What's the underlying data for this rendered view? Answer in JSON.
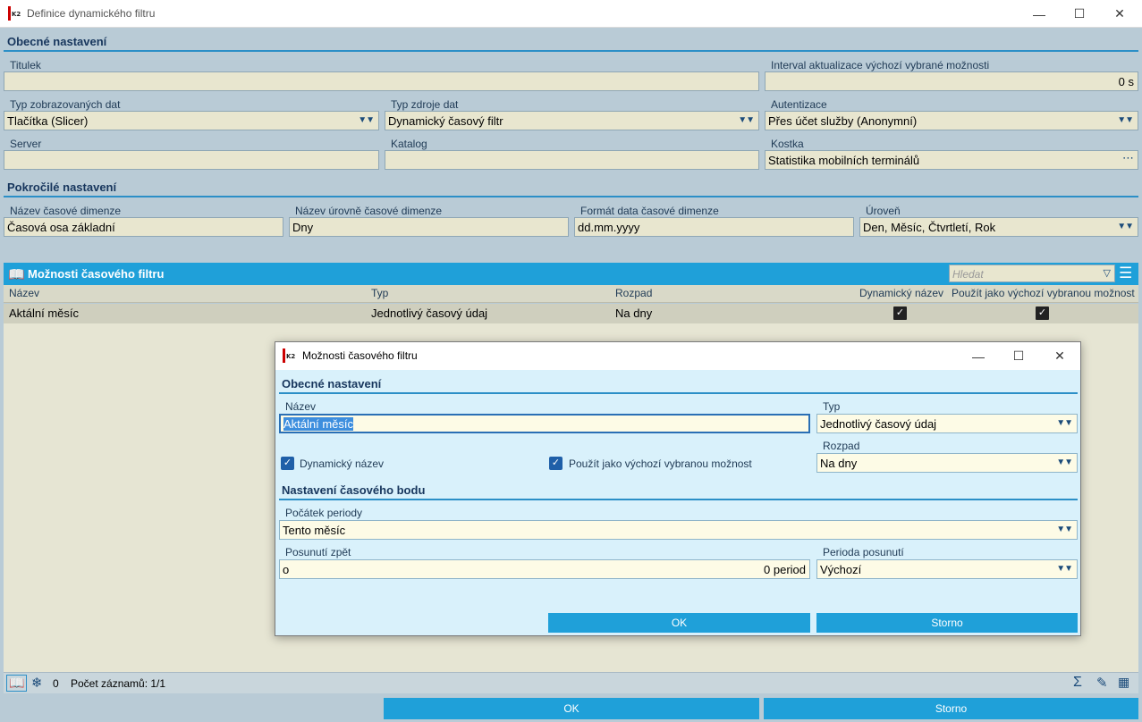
{
  "window": {
    "title": "Definice dynamického filtru"
  },
  "general": {
    "heading": "Obecné nastavení",
    "titulek": {
      "label": "Titulek",
      "value": ""
    },
    "interval": {
      "label": "Interval aktualizace výchozí vybrané možnosti",
      "value": "0 s"
    },
    "typ_dat": {
      "label": "Typ zobrazovaných dat",
      "value": "Tlačítka (Slicer)"
    },
    "typ_zdroje": {
      "label": "Typ zdroje dat",
      "value": "Dynamický časový filtr"
    },
    "autentizace": {
      "label": "Autentizace",
      "value": "Přes účet služby (Anonymní)"
    },
    "server": {
      "label": "Server",
      "value": ""
    },
    "katalog": {
      "label": "Katalog",
      "value": ""
    },
    "kostka": {
      "label": "Kostka",
      "value": "Statistika mobilních terminálů"
    }
  },
  "advanced": {
    "heading": "Pokročilé nastavení",
    "nazev_dim": {
      "label": "Název časové dimenze",
      "value": "Časová osa základní"
    },
    "nazev_urovne": {
      "label": "Název úrovně časové dimenze",
      "value": "Dny"
    },
    "format": {
      "label": "Formát data časové dimenze",
      "value": "dd.mm.yyyy"
    },
    "uroven": {
      "label": "Úroveň",
      "value": "Den, Měsíc, Čtvrtletí, Rok"
    }
  },
  "grid": {
    "title": "Možnosti časového filtru",
    "search_placeholder": "Hledat",
    "columns": [
      "Název",
      "Typ",
      "Rozpad",
      "Dynamický název",
      "Použít jako výchozí vybranou možnost"
    ],
    "rows": [
      {
        "nazev": "Aktální měsíc",
        "typ": "Jednotlivý časový údaj",
        "rozpad": "Na dny",
        "dyn": true,
        "default": true
      }
    ],
    "status_count": "0",
    "status_records": "Počet záznamů: 1/1"
  },
  "buttons": {
    "ok": "OK",
    "cancel": "Storno"
  },
  "dialog": {
    "title": "Možnosti časového filtru",
    "general_heading": "Obecné nastavení",
    "nazev": {
      "label": "Název",
      "value": "Aktální měsíc"
    },
    "typ": {
      "label": "Typ",
      "value": "Jednotlivý časový údaj"
    },
    "dyn_name": "Dynamický název",
    "use_default": "Použít jako výchozí vybranou možnost",
    "rozpad": {
      "label": "Rozpad",
      "value": "Na dny"
    },
    "time_heading": "Nastavení časového bodu",
    "pocatek": {
      "label": "Počátek periody",
      "value": "Tento měsíc"
    },
    "posunuti": {
      "label": "Posunutí zpět",
      "prefix": "o",
      "value": "0 period"
    },
    "perioda": {
      "label": "Perioda posunutí",
      "value": "Výchozí"
    },
    "ok": "OK",
    "cancel": "Storno"
  }
}
